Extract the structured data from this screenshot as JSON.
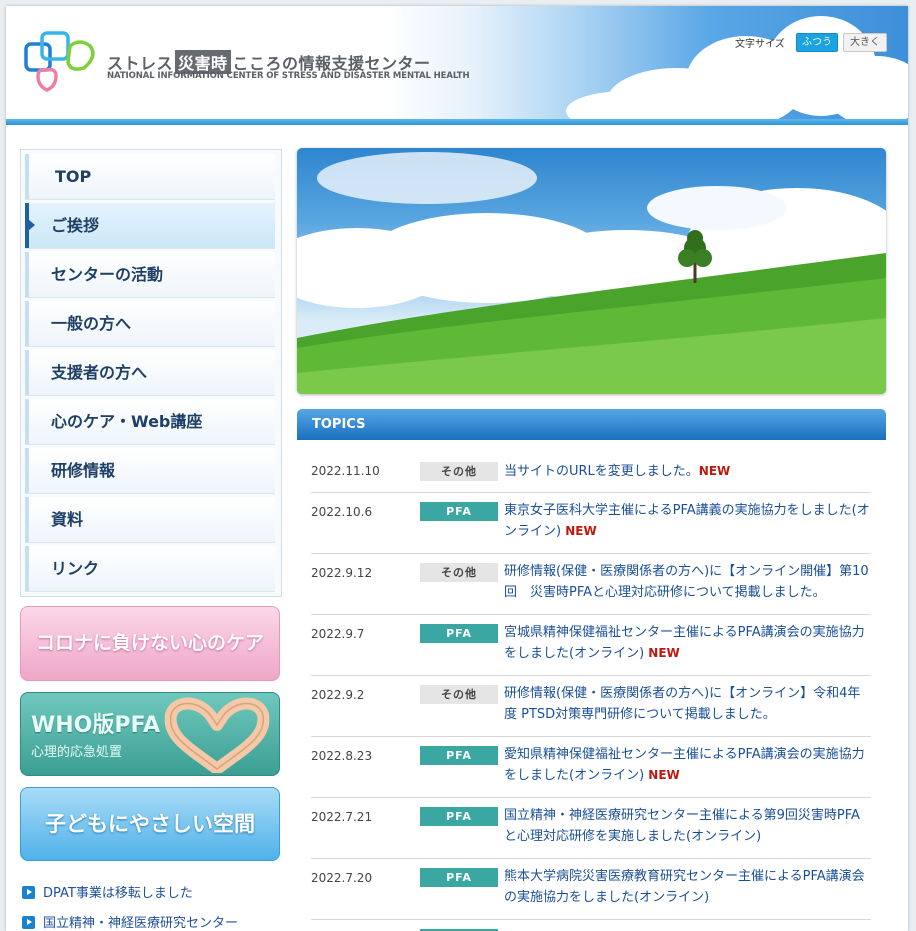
{
  "header": {
    "logo_jp_1": "ストレス",
    "logo_jp_boxed": "災害時",
    "logo_jp_2": "こころの情報支援センター",
    "logo_en": "NATIONAL INFORMATION CENTER OF STRESS AND DISASTER MENTAL HEALTH",
    "font_size_label": "文字サイズ",
    "font_normal": "ふつう",
    "font_large": "大きく"
  },
  "nav": {
    "items": [
      {
        "label": "TOP"
      },
      {
        "label": "ご挨拶"
      },
      {
        "label": "センターの活動"
      },
      {
        "label": "一般の方へ"
      },
      {
        "label": "支援者の方へ"
      },
      {
        "label": "心のケア・Web講座"
      },
      {
        "label": "研修情報"
      },
      {
        "label": "資料"
      },
      {
        "label": "リンク"
      }
    ],
    "active_index": 1
  },
  "banners": {
    "corona": "コロナに負けない心のケア",
    "who_title": "WHO版PFA",
    "who_sub": "心理的応急処置",
    "kids": "子どもにやさしい空間"
  },
  "links": [
    {
      "label": "DPAT事業は移転しました"
    },
    {
      "label": "国立精神・神経医療研究センター"
    }
  ],
  "topics": {
    "heading": "TOPICS",
    "new_label": "NEW",
    "items": [
      {
        "date": "2022.11.10",
        "tag": "その他",
        "text": "当サイトのURLを変更しました。",
        "new": true
      },
      {
        "date": "2022.10.6",
        "tag": "PFA",
        "text": "東京女子医科大学主催によるPFA講義の実施協力をしました(オンライン)",
        "new": true
      },
      {
        "date": "2022.9.12",
        "tag": "その他",
        "text": "研修情報(保健・医療関係者の方へ)に【オンライン開催】第10回　災害時PFAと心理対応研修について掲載しました。",
        "new": false
      },
      {
        "date": "2022.9.7",
        "tag": "PFA",
        "text": "宮城県精神保健福祉センター主催によるPFA講演会の実施協力をしました(オンライン)",
        "new": true
      },
      {
        "date": "2022.9.2",
        "tag": "その他",
        "text": "研修情報(保健・医療関係者の方へ)に【オンライン】令和4年度 PTSD対策専門研修について掲載しました。",
        "new": false
      },
      {
        "date": "2022.8.23",
        "tag": "PFA",
        "text": "愛知県精神保健福祉センター主催によるPFA講演会の実施協力をしました(オンライン)",
        "new": true
      },
      {
        "date": "2022.7.21",
        "tag": "PFA",
        "text": "国立精神・神経医療研究センター主催による第9回災害時PFAと心理対応研修を実施しました(オンライン)",
        "new": false
      },
      {
        "date": "2022.7.20",
        "tag": "PFA",
        "text": "熊本大学病院災害医療教育研究センター主催によるPFA講演会の実施協力をしました(オンライン)",
        "new": false
      }
    ]
  }
}
